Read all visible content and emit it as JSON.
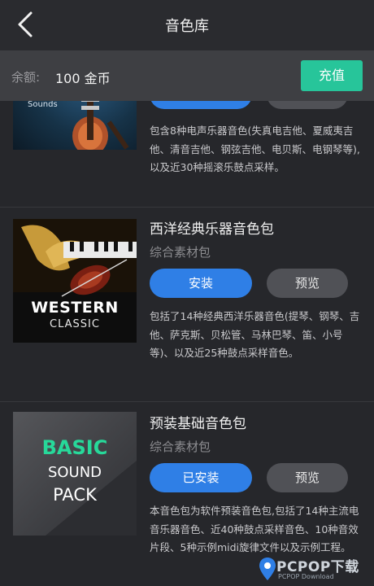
{
  "header": {
    "title": "音色库",
    "back_icon": "chevron-left-icon"
  },
  "balance": {
    "label": "余额:",
    "value": "100 金币",
    "recharge_label": "充值",
    "accent": "#27c59a"
  },
  "packs": [
    {
      "thumb_text": "Sounds",
      "description": "包含8种电声乐器音色(失真电吉他、夏威夷吉他、清音吉他、钢弦吉他、电贝斯、电钢琴等),以及近30种摇滚乐鼓点采样。"
    },
    {
      "name": "西洋经典乐器音色包",
      "subtitle": "综合素材包",
      "install_label": "安装",
      "preview_label": "预览",
      "thumb_line1": "WESTERN",
      "thumb_line2": "CLASSIC",
      "description": "包括了14种经典西洋乐器音色(提琴、钢琴、吉他、萨克斯、贝松管、马林巴琴、笛、小号等)、以及近25种鼓点采样音色。"
    },
    {
      "name": "预装基础音色包",
      "subtitle": "综合素材包",
      "install_label": "已安装",
      "preview_label": "预览",
      "thumb_line1": "BASIC",
      "thumb_line2": "SOUND",
      "thumb_line3": "PACK",
      "description": "本音色包为软件预装音色包,包括了14种主流电音乐器音色、近40种鼓点采样音色、10种音效片段、5种示例midi旋律文件以及示例工程。"
    }
  ],
  "watermark": {
    "text": "PCPOP下载",
    "sub": "PCPOP Download"
  },
  "colors": {
    "install_blue": "#2f7fe6",
    "preview_gray": "#505156",
    "background": "#26272b"
  }
}
